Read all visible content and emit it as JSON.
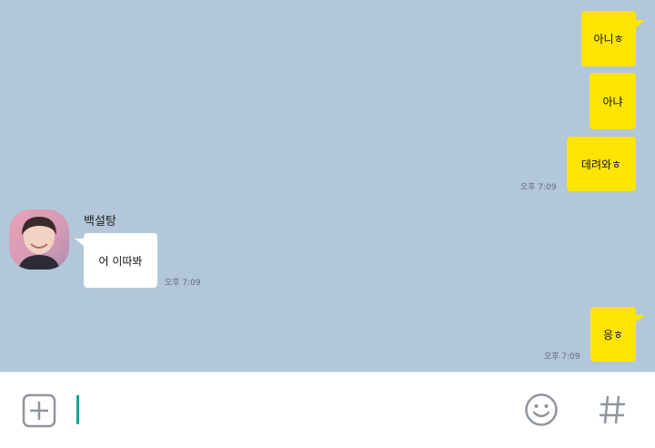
{
  "messages": [
    {
      "side": "me",
      "text": "아니ㅎ",
      "time": ""
    },
    {
      "side": "me",
      "text": "아냐",
      "time": ""
    },
    {
      "side": "me",
      "text": "데려와ㅎ",
      "time": "오후 7:09"
    },
    {
      "side": "other",
      "sender": "백설탕",
      "text": "어 이따봐",
      "time": "오후 7:09"
    },
    {
      "side": "me",
      "text": "응ㅎ",
      "time": "오후 7:09"
    }
  ],
  "input": {
    "value": "",
    "icons": [
      "plus-icon",
      "emoji-icon",
      "hashtag-icon"
    ]
  },
  "colors": {
    "background": "#b2c7da",
    "my_bubble": "#fee500",
    "their_bubble": "#ffffff",
    "caret": "#17a398"
  }
}
